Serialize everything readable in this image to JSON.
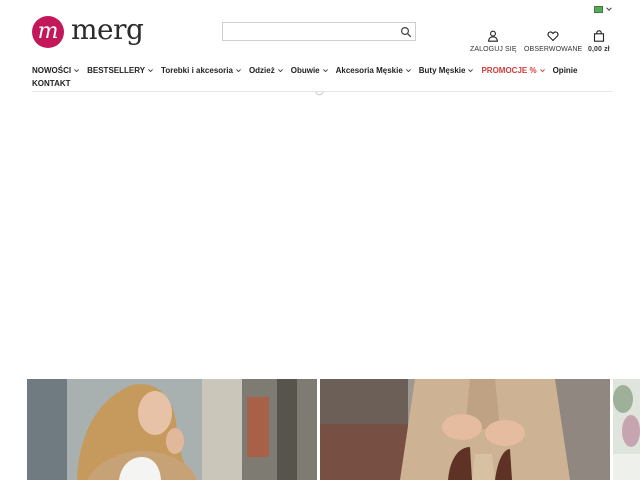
{
  "header": {
    "logo_text": "merg",
    "logo_mark": "m",
    "search": {
      "placeholder": "",
      "value": ""
    },
    "language": {
      "icon": "flag-icon"
    },
    "actions": [
      {
        "label": "ZALOGUJ SIĘ",
        "icon": "user-icon"
      },
      {
        "label": "OBSERWOWANE",
        "icon": "heart-icon"
      },
      {
        "label": "0,00 zł",
        "icon": "shopping-bag-icon"
      }
    ]
  },
  "nav": {
    "items": [
      {
        "label": "NOWOŚCI",
        "has_dropdown": true
      },
      {
        "label": "BESTSELLERY",
        "has_dropdown": true
      },
      {
        "label": "Torebki i akcesoria",
        "has_dropdown": true
      },
      {
        "label": "Odzież",
        "has_dropdown": true
      },
      {
        "label": "Obuwie",
        "has_dropdown": true
      },
      {
        "label": "Akcesoria Męskie",
        "has_dropdown": true
      },
      {
        "label": "Buty Męskie",
        "has_dropdown": true
      },
      {
        "label": "PROMOCJE %",
        "has_dropdown": true
      },
      {
        "label": "Opinie",
        "has_dropdown": false
      },
      {
        "label": "KONTAKT",
        "has_dropdown": false
      }
    ]
  },
  "colors": {
    "brand": "#c2185b",
    "promo": "#d23b3b",
    "text": "#222222"
  },
  "banners": [
    {
      "image": "woman-in-beige-coat-photo"
    },
    {
      "image": "beige-suit-with-handbag-photo"
    },
    {
      "image": "partial-photo"
    }
  ]
}
